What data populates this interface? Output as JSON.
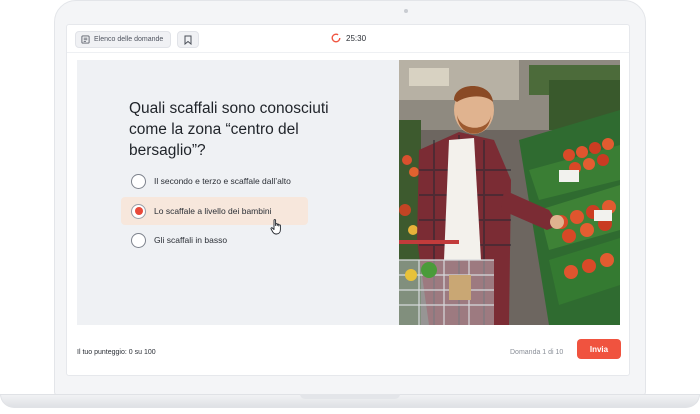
{
  "header": {
    "questions_list_label": "Elenco delle domande",
    "timer": "25:30"
  },
  "question": {
    "text": "Quali scaffali sono conosciuti come la zona “centro del bersaglio”?",
    "options": [
      {
        "label": "Il secondo e terzo e scaffale dall’alto",
        "selected": false
      },
      {
        "label": "Lo scaffale a livello dei bambini",
        "selected": true
      },
      {
        "label": "Gli scaffali in basso",
        "selected": false
      }
    ]
  },
  "footer": {
    "score": "Il tuo punteggio: 0 su 100",
    "question_counter": "Domanda 1 di 10",
    "submit_label": "Invia"
  },
  "colors": {
    "accent": "#f0533f",
    "selected_bg": "#f7e7dc",
    "content_bg": "#eff1f4"
  }
}
